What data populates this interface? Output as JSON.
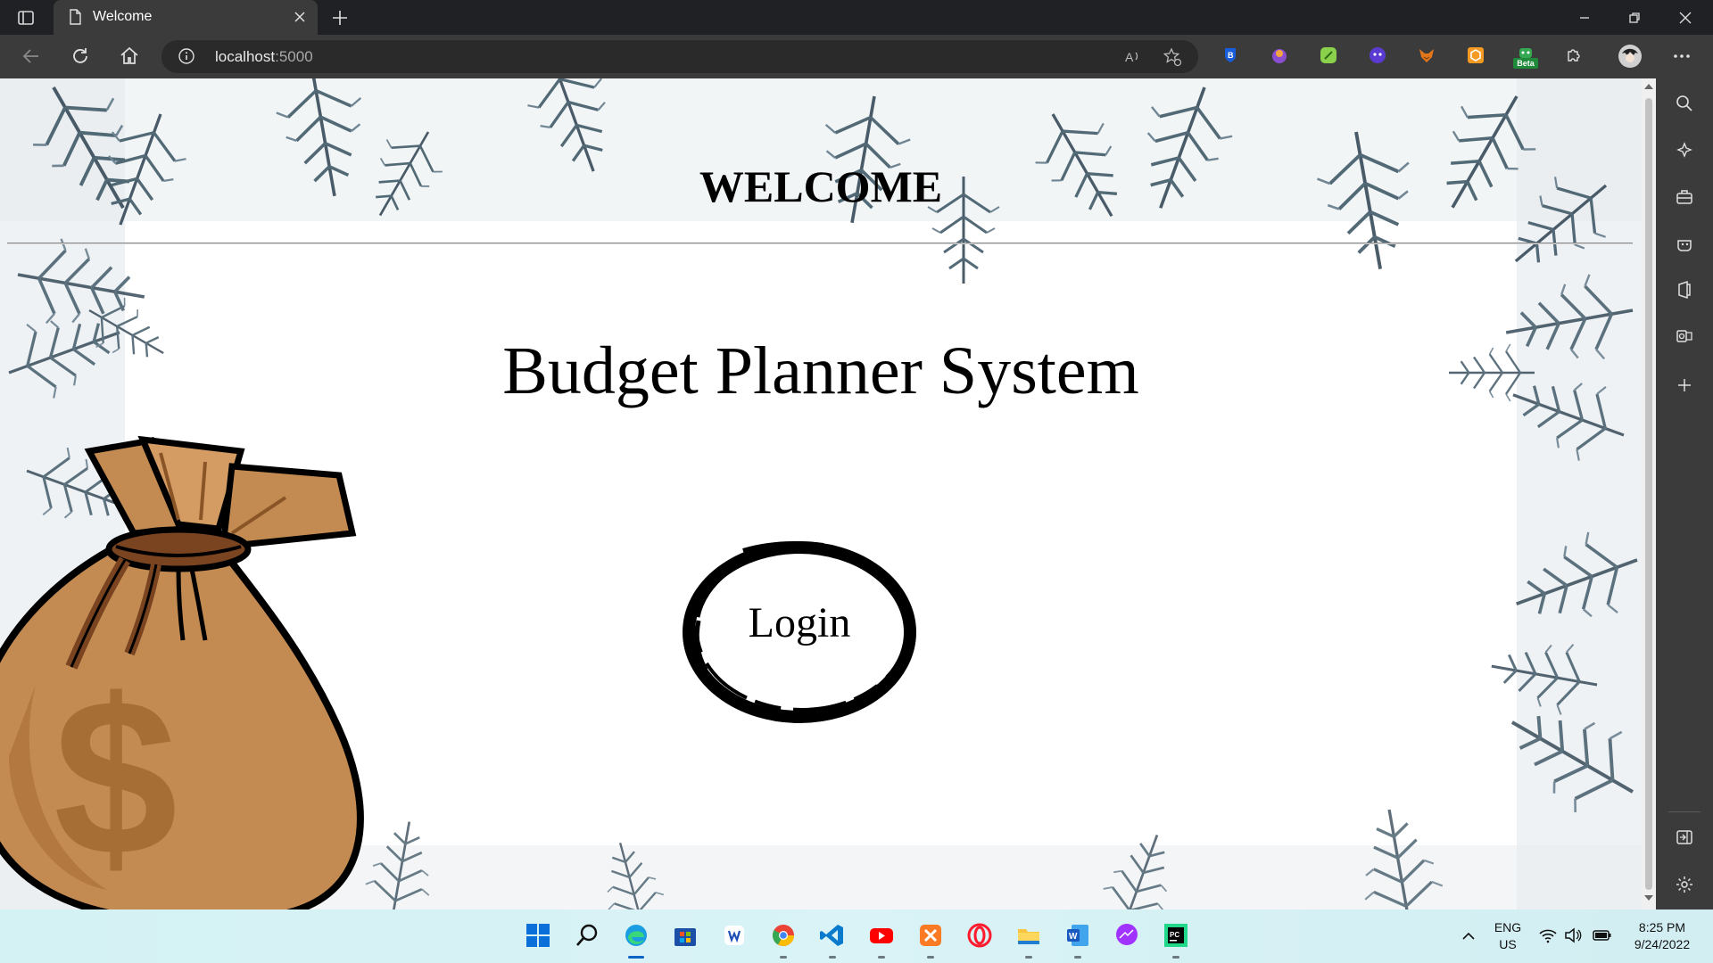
{
  "browser": {
    "tab_title": "Welcome",
    "url_host": "localhost",
    "url_port": ":5000",
    "extensions": [
      "bitwarden-icon",
      "extension-icon-purple",
      "clover-icon",
      "ghost-icon",
      "metamask-icon",
      "honey-icon",
      "beta-extension-icon",
      "puzzle-icon"
    ],
    "beta_label": "Beta"
  },
  "page": {
    "welcome": "WELCOME",
    "headline": "Budget Planner System",
    "login_label": "Login"
  },
  "taskbar": {
    "lang_line1": "ENG",
    "lang_line2": "US",
    "time": "8:25 PM",
    "date": "9/24/2022"
  },
  "colors": {
    "page_bg": "#ffffff",
    "chrome_dark": "#202124",
    "chrome_mid": "#3b3b3b",
    "bag_brown": "#c38a52",
    "taskbar_bg": "#d4f1f4"
  }
}
